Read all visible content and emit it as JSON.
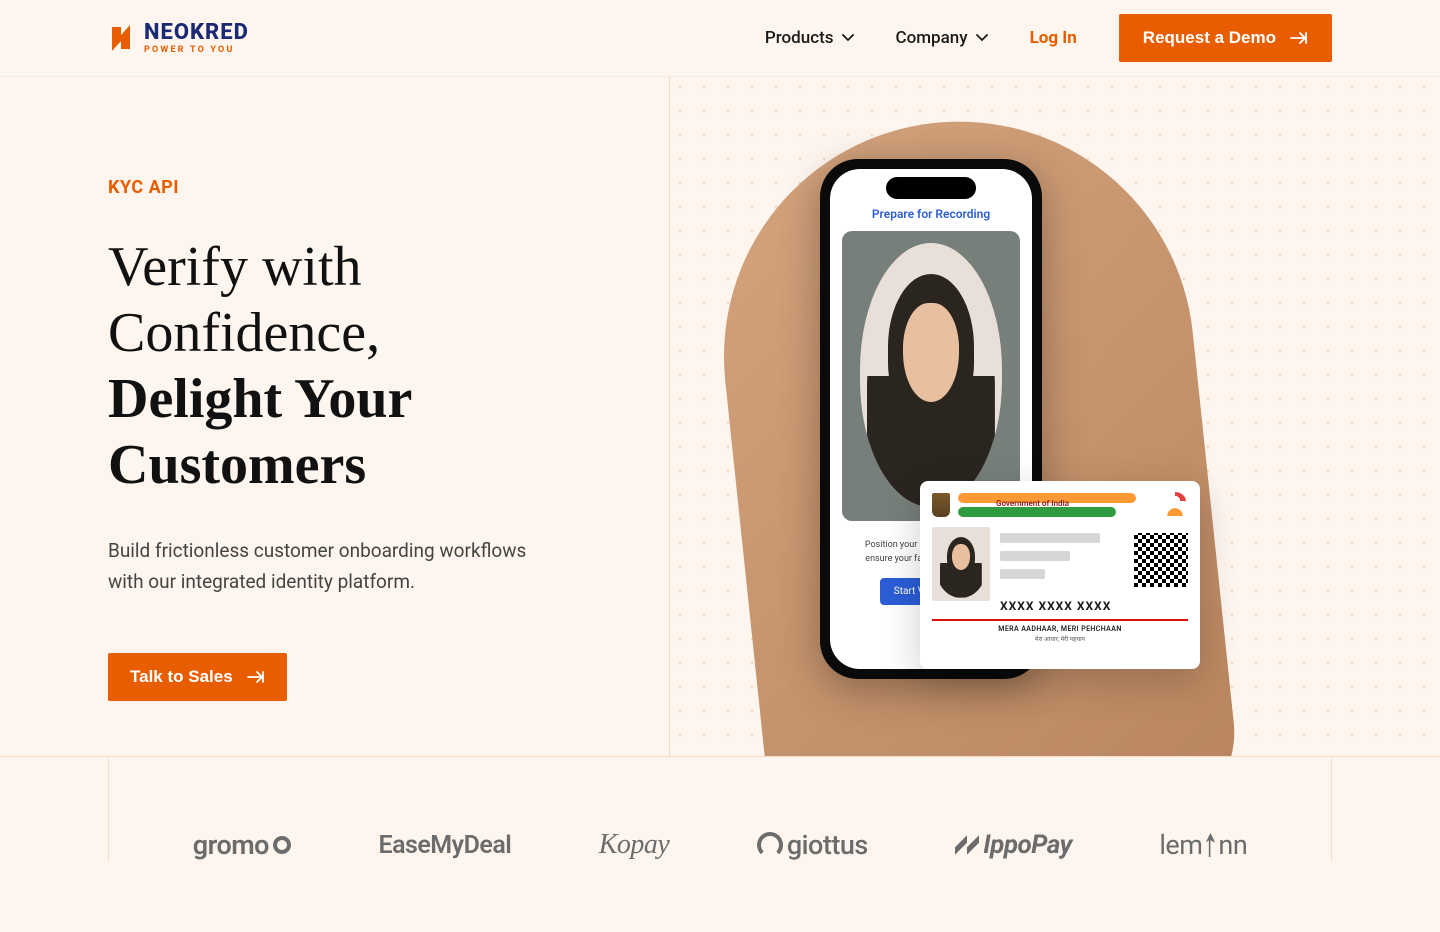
{
  "brand": {
    "name": "NEOKRED",
    "tagline": "POWER TO YOU"
  },
  "nav": {
    "products": "Products",
    "company": "Company",
    "login": "Log In",
    "demo": "Request a Demo"
  },
  "hero": {
    "eyebrow": "KYC API",
    "headline_light": "Verify with Confidence,",
    "headline_bold": "Delight Your Customers",
    "subhead": "Build frictionless customer onboarding workflows with our integrated identity platform.",
    "cta": "Talk to Sales"
  },
  "phone": {
    "title": "Prepare for Recording",
    "help1": "Position your face in the oval and",
    "help2": "ensure your face is clearly visible",
    "start": "Start Verification"
  },
  "card": {
    "header_label": "Government of India",
    "number": "XXXX XXXX XXXX",
    "footer_en": "MERA AADHAAR, MERI PEHCHAAN",
    "footer_hi": "मेरा आधार, मेरी पहचान"
  },
  "partners": {
    "p1": "gromo",
    "p2": "EaseMyDeal",
    "p3": "Kopay",
    "p4": "giottus",
    "p5": "IppoPay",
    "p6": "lemonn"
  }
}
